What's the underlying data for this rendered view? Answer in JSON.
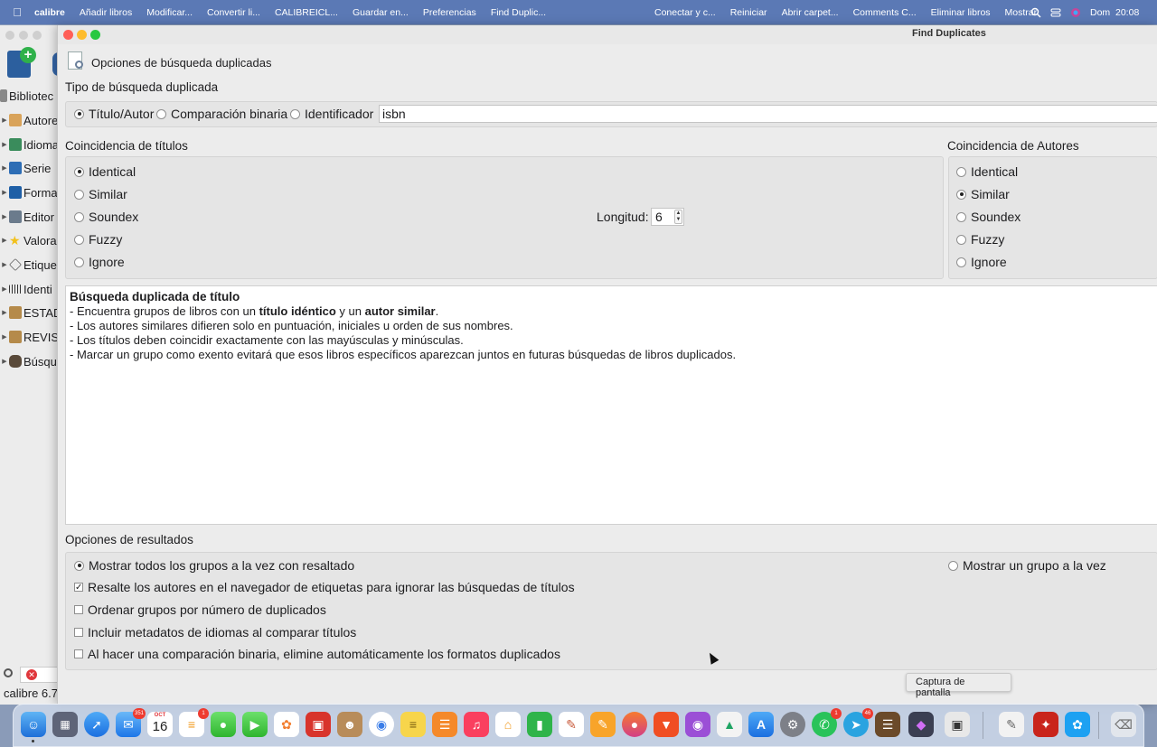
{
  "menubar": {
    "app_name": "calibre",
    "items_left": [
      "Añadir libros",
      "Modificar...",
      "Convertir li...",
      "CALIBREICL...",
      "Guardar en...",
      "Preferencias",
      "Find Duplic..."
    ],
    "items_right": [
      "Conectar y c...",
      "Reiniciar",
      "Abrir carpet...",
      "Comments C...",
      "Eliminar libros",
      "Mostrar"
    ],
    "clock": "Dom  20:08"
  },
  "calibre_main": {
    "sidebar_items": [
      "Bibliotec",
      "Autore",
      "Idioma",
      "Serie",
      "Forma",
      "Editor",
      "Valora",
      "Etique",
      "Identi",
      "ESTAD",
      "REVIS",
      "Búsqu"
    ],
    "status": "calibre 6.7"
  },
  "dialog": {
    "window_title": "Find Duplicates",
    "header": "Opciones de búsqueda duplicadas",
    "search_type": {
      "label": "Tipo de búsqueda duplicada",
      "options": [
        "Título/Autor",
        "Comparación binaria",
        "Identificador"
      ],
      "selected": 0,
      "identifier_value": "isbn"
    },
    "title_matching": {
      "label": "Coincidencia de títulos",
      "options": [
        "Identical",
        "Similar",
        "Soundex",
        "Fuzzy",
        "Ignore"
      ],
      "selected": 0,
      "length_label": "Longitud:",
      "length_value": "6"
    },
    "author_matching": {
      "label": "Coincidencia de Autores",
      "options": [
        "Identical",
        "Similar",
        "Soundex",
        "Fuzzy",
        "Ignore"
      ],
      "selected": 1
    },
    "description": {
      "title": "Búsqueda duplicada de título",
      "line1_a": "- Encuentra grupos de libros con un ",
      "line1_b": "título idéntico",
      "line1_c": " y un ",
      "line1_d": "autor similar",
      "line1_e": ".",
      "line2": "- Los autores similares difieren solo en puntuación, iniciales u orden de sus nombres.",
      "line3": "- Los títulos deben coincidir exactamente con las mayúsculas y minúsculas.",
      "line4": "- Marcar un grupo como exento evitará que esos libros específicos aparezcan juntos en futuras búsquedas de libros duplicados."
    },
    "results": {
      "label": "Opciones de resultados",
      "show_all": "Mostrar todos los grupos a la vez con resaltado",
      "show_one": "Mostrar un grupo a la vez",
      "show_all_selected": true,
      "checkboxes": [
        {
          "label": "Resalte los autores en el navegador de etiquetas para ignorar las búsquedas de títulos",
          "checked": true
        },
        {
          "label": "Ordenar grupos por número de duplicados",
          "checked": false
        },
        {
          "label": "Incluir metadatos de idiomas al comparar títulos",
          "checked": false
        },
        {
          "label": "Al hacer una comparación binaria, elimine automáticamente los formatos duplicados",
          "checked": false
        }
      ]
    }
  },
  "tooltip": "Captura de pantalla",
  "dock": {
    "calendar_month": "OCT",
    "calendar_day": "16",
    "badges": {
      "mail": "351",
      "reminders": "1",
      "whatsapp": "1",
      "telegram": "46"
    }
  }
}
